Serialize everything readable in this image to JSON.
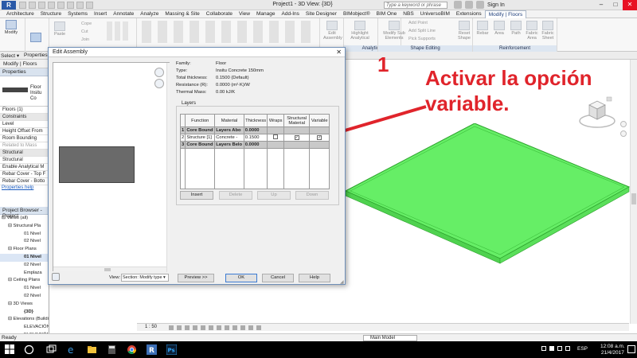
{
  "app": {
    "logo": "R",
    "window_title": "Project1 - 3D View: {3D}",
    "search_placeholder": "Type a keyword or phrase",
    "sign_in": "Sign In"
  },
  "ribbon": {
    "tabs": [
      "Architecture",
      "Structure",
      "Systems",
      "Insert",
      "Annotate",
      "Analyze",
      "Massing & Site",
      "Collaborate",
      "View",
      "Manage",
      "Add-Ins",
      "Site Designer",
      "BIMobject®",
      "BIM One",
      "NBS",
      "UniversoBIM",
      "Extensions",
      "Modify | Floors"
    ],
    "active_tab": "Modify | Floors",
    "modify_label": "Modify",
    "small_buttons": [
      "Cope",
      "Cut",
      "Join",
      "Paste"
    ],
    "edit_assembly_label": "Edit Assembly",
    "highlight_analytical": "Highlight Analytical",
    "modify_sub_elements": "Modify Sub Elements",
    "shape_editing": [
      "Add Point",
      "Add Split Line",
      "Pick Supports"
    ],
    "reset_shape": "Reset Shape",
    "reinforcement": [
      "Rebar",
      "Area",
      "Path",
      "Fabric Area",
      "Fabric Sheet"
    ],
    "groups": [
      "Analytical",
      "Shape Editing",
      "Reinforcement"
    ]
  },
  "options_bar": {
    "select": "Select",
    "properties": "Properties"
  },
  "context_row": "Modify | Floors",
  "properties": {
    "header": "Properties",
    "type_name_line1": "Floor",
    "type_name_line2": "Insitu Co",
    "count": "Floors (1)",
    "rows": [
      {
        "label": "Constraints",
        "section": true
      },
      {
        "label": "Level"
      },
      {
        "label": "Height Offset From"
      },
      {
        "label": "Room Bounding"
      },
      {
        "label": "Related to Mass",
        "dim": true
      },
      {
        "label": "Structural",
        "section": true
      },
      {
        "label": "Structural"
      },
      {
        "label": "Enable Analytical M"
      },
      {
        "label": "Rebar Cover - Top F"
      },
      {
        "label": "Rebar Cover - Botto"
      }
    ],
    "help_link": "Properties help"
  },
  "browser": {
    "header": "Project Browser - Project",
    "rows": [
      {
        "text": "⊟ Views (all)",
        "indent": 2
      },
      {
        "text": "⊟ Structural Pla",
        "indent": 10
      },
      {
        "text": "01 Nivel",
        "indent": 30
      },
      {
        "text": "02 Nivel",
        "indent": 30
      },
      {
        "text": "⊟ Floor Plans",
        "indent": 10
      },
      {
        "text": "01 Nivel",
        "indent": 30,
        "sel": true
      },
      {
        "text": "02 Nivel",
        "indent": 30
      },
      {
        "text": "Emplaza",
        "indent": 30
      },
      {
        "text": "⊟ Ceiling Plans",
        "indent": 10
      },
      {
        "text": "01 Nivel",
        "indent": 30
      },
      {
        "text": "02 Nivel",
        "indent": 30
      },
      {
        "text": "⊟ 3D Views",
        "indent": 10
      },
      {
        "text": "{3D}",
        "indent": 30,
        "bold": true
      },
      {
        "text": "⊟ Elevations (Building Elevation)",
        "indent": 10
      },
      {
        "text": "ELEVACIÓN FRONTAL",
        "indent": 30
      },
      {
        "text": "ELEVACIÓN LATERAL DERECHA",
        "indent": 30
      }
    ]
  },
  "dialog": {
    "title": "Edit Assembly",
    "close": "✕",
    "info": [
      {
        "k": "Family:",
        "v": "Floor"
      },
      {
        "k": "Type:",
        "v": "Insitu Concrete 150mm"
      },
      {
        "k": "Total thickness:",
        "v": "0.1500 (Default)"
      },
      {
        "k": "Resistance (R):",
        "v": "0.0000 (m²·K)/W"
      },
      {
        "k": "Thermal Mass:",
        "v": "0.00 kJ/K"
      }
    ],
    "layers_label": "Layers",
    "columns": [
      "",
      "Function",
      "Material",
      "Thickness",
      "Wraps",
      "Structural Material",
      "Variable"
    ],
    "layers": [
      {
        "num": "1",
        "function": "Core Bound",
        "material": "Layers Abo",
        "thickness": "0.0000",
        "core": true
      },
      {
        "num": "2",
        "function": "Structure [1]",
        "material": "Concrete -",
        "thickness": "0.1500",
        "core": false,
        "structural": "✓",
        "variable": "✓"
      },
      {
        "num": "3",
        "function": "Core Bound",
        "material": "Layers Belo",
        "thickness": "0.0000",
        "core": true
      }
    ],
    "buttons": {
      "insert": "Insert",
      "delete": "Delete",
      "up": "Up",
      "down": "Down"
    },
    "view_label": "View:",
    "view_value": "Section: Modify type",
    "preview": "Preview >>",
    "ok": "OK",
    "cancel": "Cancel",
    "help": "Help"
  },
  "annotation": {
    "number": "1",
    "text": "Activar la opción\nvariable.",
    "color": "#e0242b"
  },
  "view_bar": {
    "scale": "1 : 50"
  },
  "status": {
    "text": "Ready",
    "model": "Main Model"
  },
  "taskbar": {
    "lang": "ESP",
    "time": "12:08 a.m.",
    "date": "21/4/2017"
  },
  "colors": {
    "floor_fill": "#66ee66",
    "floor_edge": "#2ea32e",
    "accent": "#e0242b"
  }
}
